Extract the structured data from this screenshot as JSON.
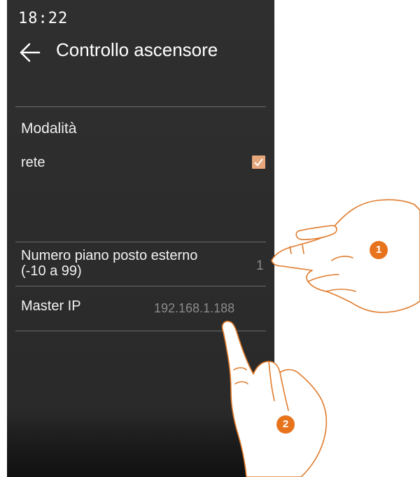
{
  "status_bar": {
    "time": "18:22"
  },
  "header": {
    "back_icon": "arrow-left-icon",
    "title": "Controllo ascensore"
  },
  "mode_section": {
    "label": "Modalità",
    "value": "rete",
    "checked": true
  },
  "floor_field": {
    "label": "Numero piano posto esterno (-10 a 99)",
    "value": "1"
  },
  "master_ip_field": {
    "label": "Master IP",
    "value": "192.168.1.188"
  },
  "callouts": [
    {
      "number": "1",
      "icon": "pointing-hand-icon"
    },
    {
      "number": "2",
      "icon": "tapping-hand-icon"
    }
  ],
  "colors": {
    "screen_bg": "#2f2f2f",
    "accent_checkbox": "#e6a77d",
    "callout_badge": "#e8731d",
    "hand_outline": "#e07a2a"
  }
}
